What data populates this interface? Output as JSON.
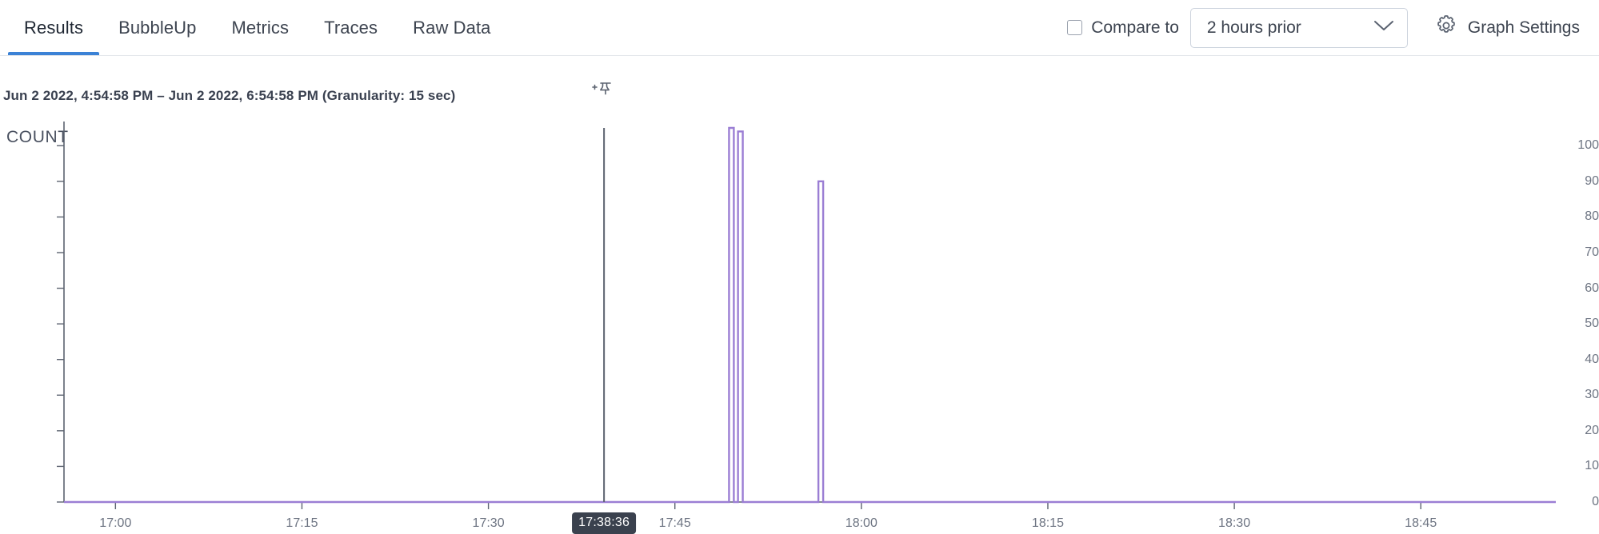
{
  "header": {
    "tabs": [
      {
        "label": "Results",
        "active": true
      },
      {
        "label": "BubbleUp",
        "active": false
      },
      {
        "label": "Metrics",
        "active": false
      },
      {
        "label": "Traces",
        "active": false
      },
      {
        "label": "Raw Data",
        "active": false
      }
    ],
    "compare": {
      "label": "Compare to",
      "checked": false,
      "select_value": "2 hours prior",
      "select_options": [
        "2 hours prior"
      ],
      "chevron_icon": "chevron-down-icon"
    },
    "graph_settings": {
      "label": "Graph Settings",
      "icon": "gear-icon"
    },
    "active_tab_underline_color": "#3b82d6"
  },
  "subtitle": "Jun 2 2022, 4:54:58 PM – Jun 2 2022, 6:54:58 PM (Granularity: 15 sec)",
  "cursor": {
    "badge_label": "17:38:36",
    "pin_icon": "pushpin-add-icon",
    "line_color": "#5c6370",
    "badge_bg": "#3a414e"
  },
  "chart_data": {
    "type": "line",
    "title": "COUNT",
    "xlabel": "",
    "ylabel": "COUNT",
    "series_color": "#9b7ed4",
    "axis_color": "#5c6370",
    "grid": false,
    "legend": "none",
    "ylim": [
      0,
      105
    ],
    "yticks": [
      0,
      10,
      20,
      30,
      40,
      50,
      60,
      70,
      80,
      90,
      100
    ],
    "xlim": [
      "16:54:58",
      "18:54:58"
    ],
    "xticks": [
      "17:00",
      "17:15",
      "17:30",
      "17:45",
      "18:00",
      "18:15",
      "18:30",
      "18:45"
    ],
    "xtick_fractions": [
      0.0345,
      0.1595,
      0.2845,
      0.4095,
      0.5345,
      0.6595,
      0.7845,
      0.9095
    ],
    "points": [
      {
        "time": "16:54:58",
        "value": 0
      },
      {
        "time": "17:47:10",
        "value": 0
      },
      {
        "time": "17:47:25",
        "value": 105
      },
      {
        "time": "17:47:40",
        "value": 0
      },
      {
        "time": "17:47:55",
        "value": 0
      },
      {
        "time": "17:48:10",
        "value": 104
      },
      {
        "time": "17:48:25",
        "value": 0
      },
      {
        "time": "17:53:30",
        "value": 0
      },
      {
        "time": "17:53:45",
        "value": 90
      },
      {
        "time": "17:54:00",
        "value": 0
      },
      {
        "time": "18:54:58",
        "value": 0
      }
    ],
    "spikes": [
      {
        "time": "17:47:25",
        "value": 105,
        "x_fraction": 0.4474
      },
      {
        "time": "17:48:10",
        "value": 104,
        "x_fraction": 0.4534
      },
      {
        "time": "17:53:45",
        "value": 90,
        "x_fraction": 0.5073
      }
    ]
  }
}
